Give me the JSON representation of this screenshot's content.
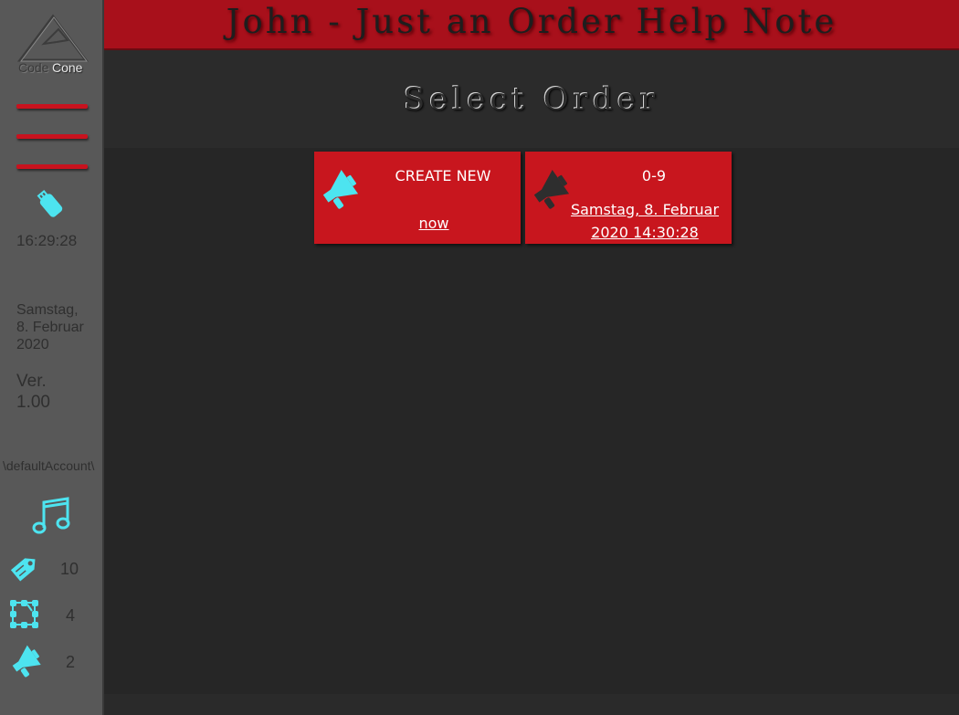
{
  "sidebar": {
    "logo_text": "Code",
    "logo_text2": "Cone",
    "time": "16:29:28",
    "date_line1": "Samstag,",
    "date_line2": "8. Februar",
    "date_line3": "2020",
    "version_line1": "Ver.",
    "version_line2": "1.00",
    "account": "\\defaultAccount\\",
    "stats": [
      {
        "icon": "tag-icon",
        "count": "10"
      },
      {
        "icon": "nodes-icon",
        "count": "4"
      },
      {
        "icon": "megaphone-icon",
        "count": "2"
      }
    ],
    "icons": [
      "usb-icon",
      "music-icon"
    ]
  },
  "header": {
    "title": "John - Just an Order Help Note"
  },
  "main": {
    "subtitle": "Select Order",
    "cards": [
      {
        "title": "CREATE NEW",
        "link_line1": "now",
        "link_line2": "",
        "icon": "megaphone-icon"
      },
      {
        "title": "0-9",
        "link_line1": "Samstag, 8. Februar",
        "link_line2": "2020 14:30:28",
        "icon": "megaphone-icon"
      }
    ]
  },
  "colors": {
    "accent_red": "#c8161e",
    "icon_cyan": "#4de4f0",
    "sidebar_bg": "#585858",
    "main_bg": "#262626"
  }
}
